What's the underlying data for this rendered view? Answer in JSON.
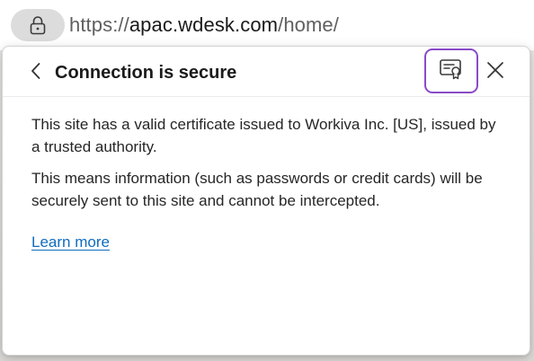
{
  "address_bar": {
    "url_scheme": "https://",
    "url_host": "apac.wdesk.com",
    "url_path": "/home/"
  },
  "popup": {
    "title": "Connection is secure",
    "body_paragraphs": [
      "This site has a valid certificate issued to Workiva Inc. [US], issued by a trusted authority.",
      "This means information (such as passwords or credit cards) will be securely sent to this site and cannot be intercepted."
    ],
    "learn_more_label": "Learn more"
  },
  "icons": {
    "lock": "lock-icon",
    "back": "chevron-left-icon",
    "certificate": "certificate-icon",
    "close": "close-icon"
  },
  "colors": {
    "link": "#0f6cbd",
    "focus_ring": "#8a4ac8",
    "lock_pill": "#dcdcdc"
  }
}
